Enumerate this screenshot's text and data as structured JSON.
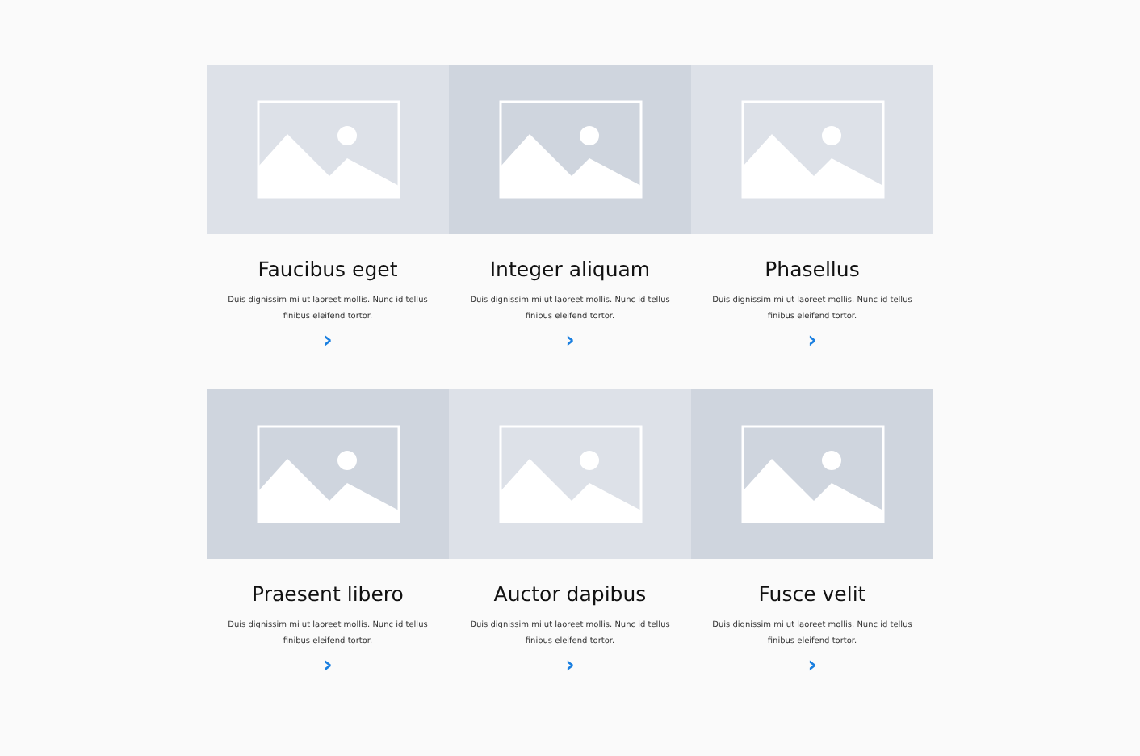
{
  "cards": [
    {
      "title": "Faucibus eget",
      "text": "Duis dignissim mi ut laoreet mollis. Nunc id tellus finibus eleifend tortor.",
      "link": "›",
      "color": "#dde1e8"
    },
    {
      "title": "Integer aliquam",
      "text": "Duis dignissim mi ut laoreet mollis. Nunc id tellus finibus eleifend tortor.",
      "link": "›",
      "color": "#cfd5de"
    },
    {
      "title": "Phasellus",
      "text": "Duis dignissim mi ut laoreet mollis. Nunc id tellus finibus eleifend tortor.",
      "link": "›",
      "color": "#dde1e8"
    },
    {
      "title": "Praesent libero",
      "text": "Duis dignissim mi ut laoreet mollis. Nunc id tellus finibus eleifend tortor.",
      "link": "›",
      "color": "#cfd5de"
    },
    {
      "title": "Auctor dapibus",
      "text": "Duis dignissim mi ut laoreet mollis. Nunc id tellus finibus eleifend tortor.",
      "link": "›",
      "color": "#dde1e8"
    },
    {
      "title": "Fusce velit",
      "text": "Duis dignissim mi ut laoreet mollis. Nunc id tellus finibus eleifend tortor.",
      "link": "›",
      "color": "#cfd5de"
    }
  ]
}
